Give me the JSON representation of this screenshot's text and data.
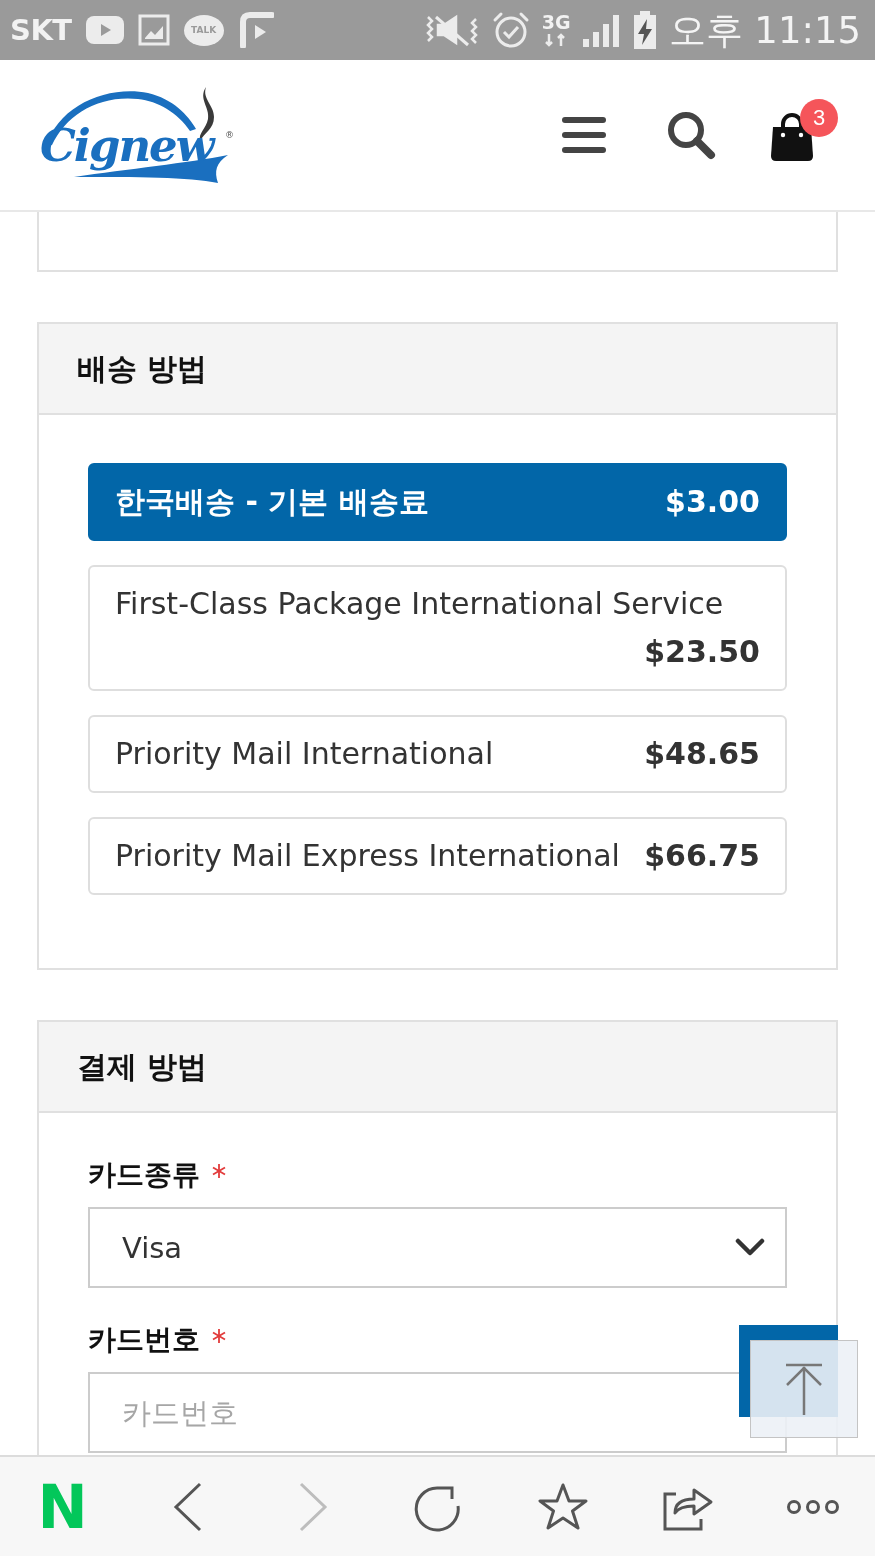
{
  "status_bar": {
    "carrier": "SKT",
    "chat_app_label": "TALK",
    "network": "3G",
    "time": "오후 11:15"
  },
  "header": {
    "logo": "Cignew",
    "logo_mark": "®",
    "cart_count": "3"
  },
  "shipping": {
    "title": "배송 방법",
    "options": [
      {
        "name": "한국배송 - 기본 배송료",
        "price": "$3.00",
        "selected": true
      },
      {
        "name": "First-Class Package International Service",
        "price": "$23.50",
        "selected": false
      },
      {
        "name": "Priority Mail International",
        "price": "$48.65",
        "selected": false
      },
      {
        "name": "Priority Mail Express International",
        "price": "$66.75",
        "selected": false
      }
    ]
  },
  "payment": {
    "title": "결제 방법",
    "fields": [
      {
        "kind": "select",
        "label": "카드종류",
        "required": true,
        "value": "Visa"
      },
      {
        "kind": "input",
        "label": "카드번호",
        "required": true,
        "placeholder": "카드번호"
      }
    ]
  },
  "browser_bar": {
    "logo": "N",
    "buttons": [
      {
        "kind": "back",
        "disabled": false
      },
      {
        "kind": "forward",
        "disabled": true
      },
      {
        "kind": "refresh",
        "disabled": false
      },
      {
        "kind": "bookmark",
        "disabled": false
      },
      {
        "kind": "share",
        "disabled": false
      },
      {
        "kind": "more",
        "disabled": false
      }
    ]
  }
}
